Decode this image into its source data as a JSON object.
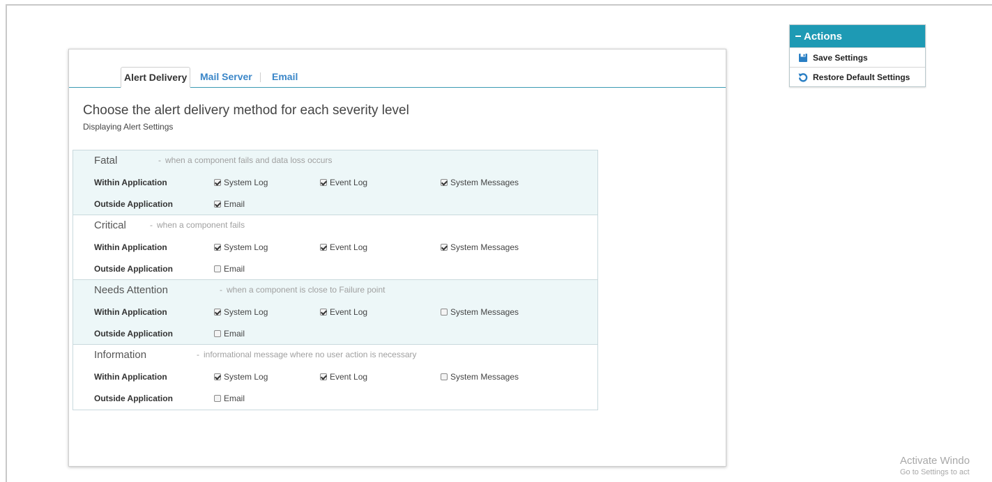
{
  "tabs": [
    {
      "label": "Alert Delivery",
      "active": true
    },
    {
      "label": "Mail Server",
      "active": false
    },
    {
      "label": "Email",
      "active": false
    }
  ],
  "heading": "Choose the alert delivery method for each severity level",
  "subheading": "Displaying Alert Settings",
  "row_labels": {
    "within": "Within Application",
    "outside": "Outside Application"
  },
  "option_labels": {
    "system_log": "System Log",
    "event_log": "Event Log",
    "system_messages": "System Messages",
    "email": "Email"
  },
  "separator": "-",
  "sections": [
    {
      "title": "Fatal",
      "desc": "when a component fails and data loss occurs",
      "system_log": true,
      "event_log": true,
      "system_messages": true,
      "email": true
    },
    {
      "title": "Critical",
      "desc": "when a component fails",
      "system_log": true,
      "event_log": true,
      "system_messages": true,
      "email": false
    },
    {
      "title": "Needs Attention",
      "desc": "when a component is close to Failure point",
      "system_log": true,
      "event_log": true,
      "system_messages": false,
      "email": false
    },
    {
      "title": "Information",
      "desc": "informational message where no user action is necessary",
      "system_log": true,
      "event_log": true,
      "system_messages": false,
      "email": false
    }
  ],
  "actions": {
    "title": "Actions",
    "save_label": "Save Settings",
    "restore_label": "Restore Default Settings"
  },
  "watermark": {
    "line1": "Activate Windo",
    "line2": "Go to Settings to act"
  },
  "colors": {
    "accent": "#1e9ab4",
    "link": "#3a86c8",
    "shaded_row": "#edf7f8"
  }
}
